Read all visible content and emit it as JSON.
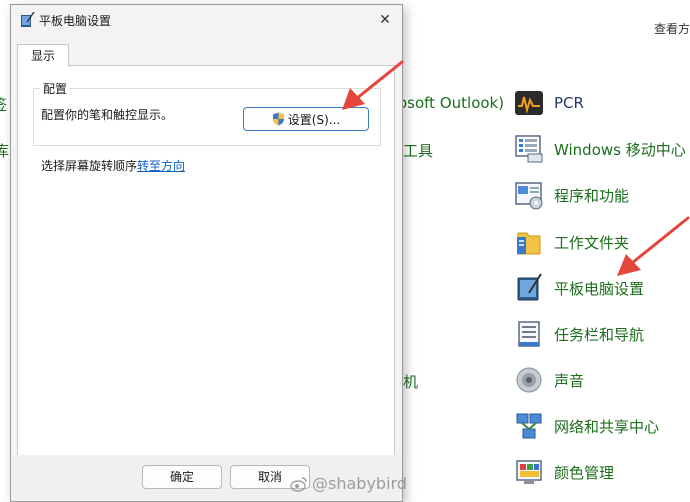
{
  "control_panel": {
    "view_by": "查看方",
    "fragments": {
      "outlook": "osoft Outlook)",
      "tools": "工具",
      "left_a": "签",
      "left_b": "库",
      "machine": "机"
    },
    "items": [
      {
        "label": "PCR",
        "icon": "pcr-icon"
      },
      {
        "label": "Windows 移动中心",
        "icon": "mobility-center-icon"
      },
      {
        "label": "程序和功能",
        "icon": "programs-features-icon"
      },
      {
        "label": "工作文件夹",
        "icon": "work-folders-icon"
      },
      {
        "label": "平板电脑设置",
        "icon": "tablet-pc-settings-icon"
      },
      {
        "label": "任务栏和导航",
        "icon": "taskbar-navigation-icon"
      },
      {
        "label": "声音",
        "icon": "sound-icon"
      },
      {
        "label": "网络和共享中心",
        "icon": "network-sharing-icon"
      },
      {
        "label": "颜色管理",
        "icon": "color-management-icon"
      }
    ]
  },
  "dialog": {
    "title": "平板电脑设置",
    "close_glyph": "✕",
    "tab_label": "显示",
    "group_title": "配置",
    "group_desc": "配置你的笔和触控显示。",
    "settings_button": "设置(S)...",
    "rotation_prefix": "选择屏幕旋转顺序",
    "rotation_link": "转至方向",
    "ok_button": "确定",
    "cancel_button": "取消"
  },
  "watermark": "@shabybird",
  "colors": {
    "link_green": "#1c6e1c",
    "link_blue": "#0a5ec8",
    "arrow_red": "#e5453b",
    "focus_blue": "#3a78c8"
  }
}
